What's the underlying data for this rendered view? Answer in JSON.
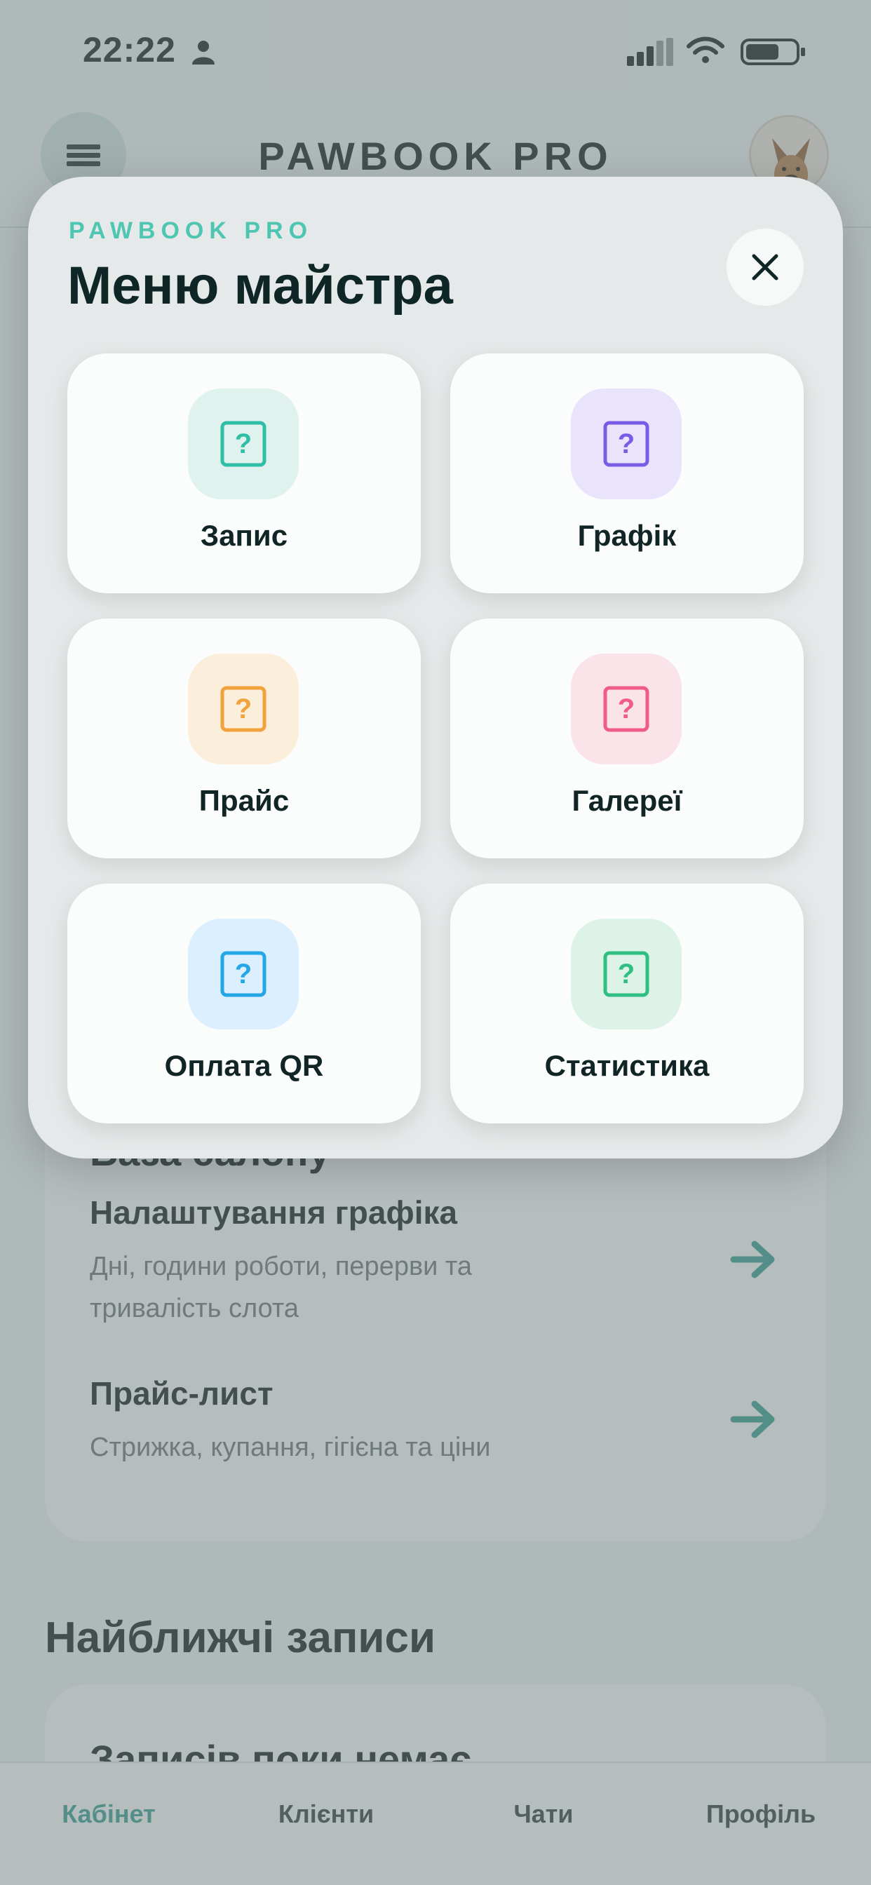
{
  "status_bar": {
    "time": "22:22"
  },
  "header": {
    "title": "PAWBOOK PRO"
  },
  "background": {
    "card_partial_title": "База салону",
    "settings": [
      {
        "title": "Налаштування графіка",
        "description_line1": "Дні, години роботи, перерви та",
        "description_line2": "тривалість слота"
      },
      {
        "title": "Прайс-лист",
        "description_line1": "Стрижка, купання, гігієна та ціни"
      }
    ],
    "upcoming_title": "Найближчі записи",
    "empty_title": "Записів поки немає"
  },
  "tabs": [
    {
      "label": "Кабінет",
      "active": true
    },
    {
      "label": "Клієнти",
      "active": false
    },
    {
      "label": "Чати",
      "active": false
    },
    {
      "label": "Профіль",
      "active": false
    }
  ],
  "modal": {
    "eyebrow": "PAWBOOK PRO",
    "title": "Меню майстра",
    "tiles": [
      {
        "label": "Запис",
        "icon": "placeholder-icon",
        "color": "#2fbfa6",
        "bg": "#dff2ee"
      },
      {
        "label": "Графік",
        "icon": "placeholder-icon",
        "color": "#7a5be6",
        "bg": "#e9e4fb"
      },
      {
        "label": "Прайс",
        "icon": "placeholder-icon",
        "color": "#f2a23a",
        "bg": "#fbefdc"
      },
      {
        "label": "Галереї",
        "icon": "placeholder-icon",
        "color": "#ef5b8a",
        "bg": "#fbe3ea"
      },
      {
        "label": "Оплата QR",
        "icon": "placeholder-icon",
        "color": "#23a7e6",
        "bg": "#dcefff"
      },
      {
        "label": "Статистика",
        "icon": "placeholder-icon",
        "color": "#2fbf82",
        "bg": "#ddf3e8"
      }
    ]
  },
  "colors": {
    "accent": "#2f9a8c",
    "eyebrow": "#4fc6b2"
  }
}
